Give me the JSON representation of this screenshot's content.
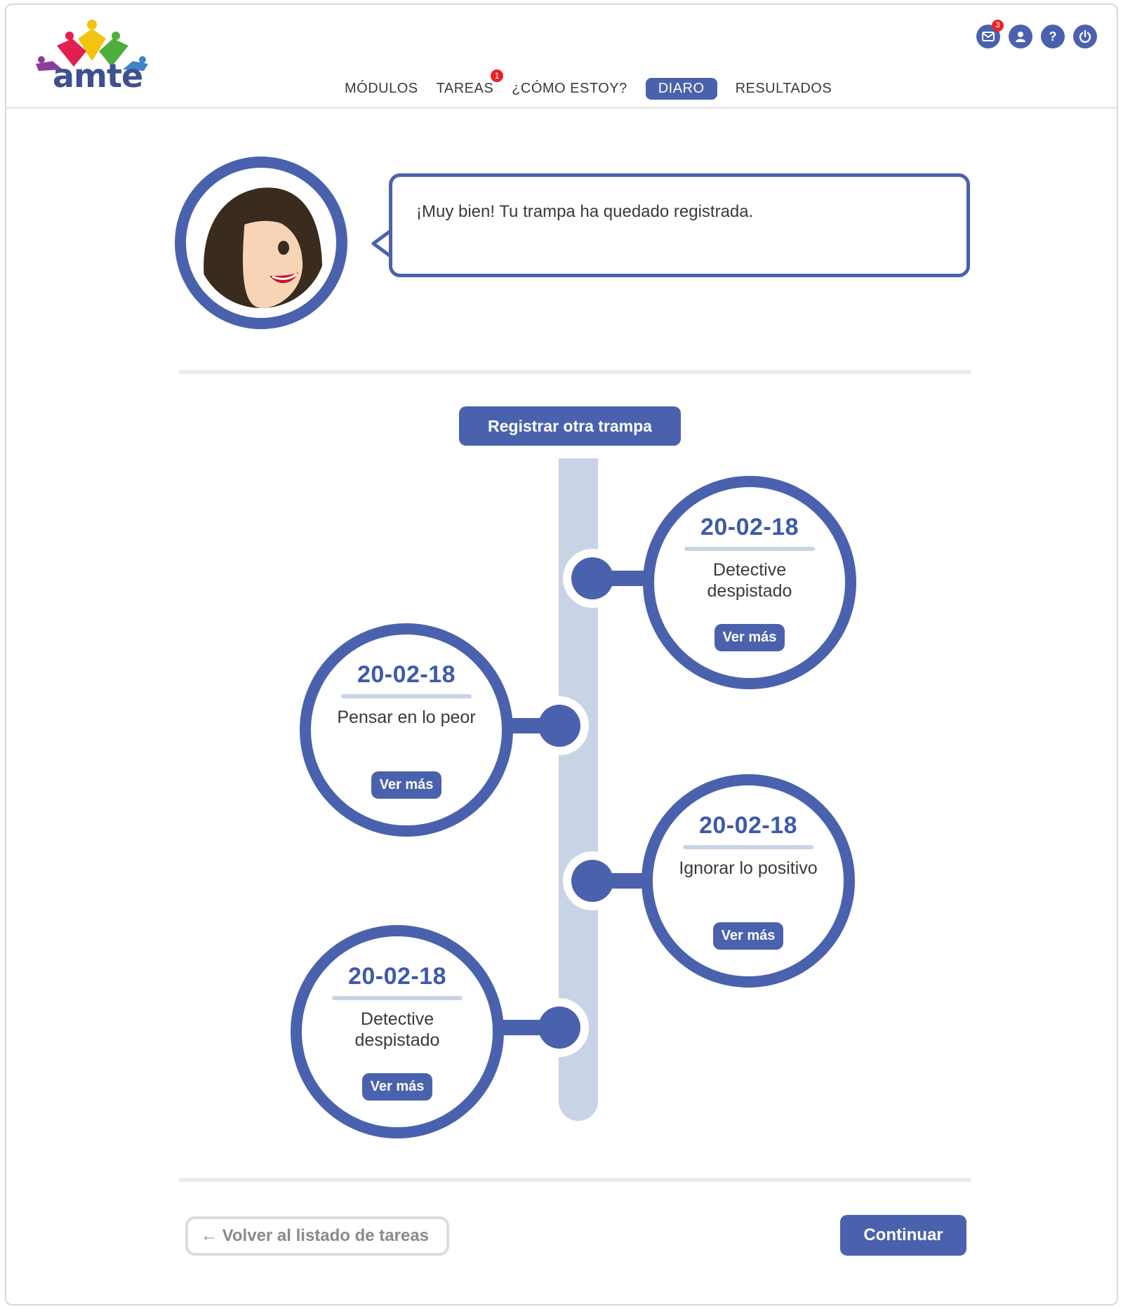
{
  "app": {
    "logo_text": "amte"
  },
  "nav": {
    "items": [
      {
        "label": "MÓDULOS"
      },
      {
        "label": "TAREAS",
        "badge": "1"
      },
      {
        "label": "¿CÓMO ESTOY?"
      },
      {
        "label": "DIARO",
        "active": true
      },
      {
        "label": "RESULTADOS"
      }
    ]
  },
  "header_icons": {
    "mail_count": "3",
    "mail_icon": "envelope-icon",
    "profile_icon": "user-icon",
    "help_icon": "question-icon",
    "power_icon": "power-icon",
    "help_glyph": "?"
  },
  "message": {
    "text": "¡Muy bien! Tu trampa ha quedado registrada."
  },
  "register_button": "Registrar otra trampa",
  "timeline": {
    "entries": [
      {
        "date": "20-02-18",
        "title": "Detective despistado",
        "button": "Ver más",
        "side": "right"
      },
      {
        "date": "20-02-18",
        "title": "Pensar en lo peor",
        "button": "Ver más",
        "side": "left"
      },
      {
        "date": "20-02-18",
        "title": "Ignorar lo positivo",
        "button": "Ver más",
        "side": "right"
      },
      {
        "date": "20-02-18",
        "title": "Detective despistado",
        "button": "Ver más",
        "side": "left"
      }
    ]
  },
  "footer": {
    "back_label": "← Volver al listado de tareas",
    "continue_label": "Continuar"
  },
  "colors": {
    "primary": "#4a62ad",
    "spine": "#c9d3e6",
    "badge": "#e62429"
  }
}
